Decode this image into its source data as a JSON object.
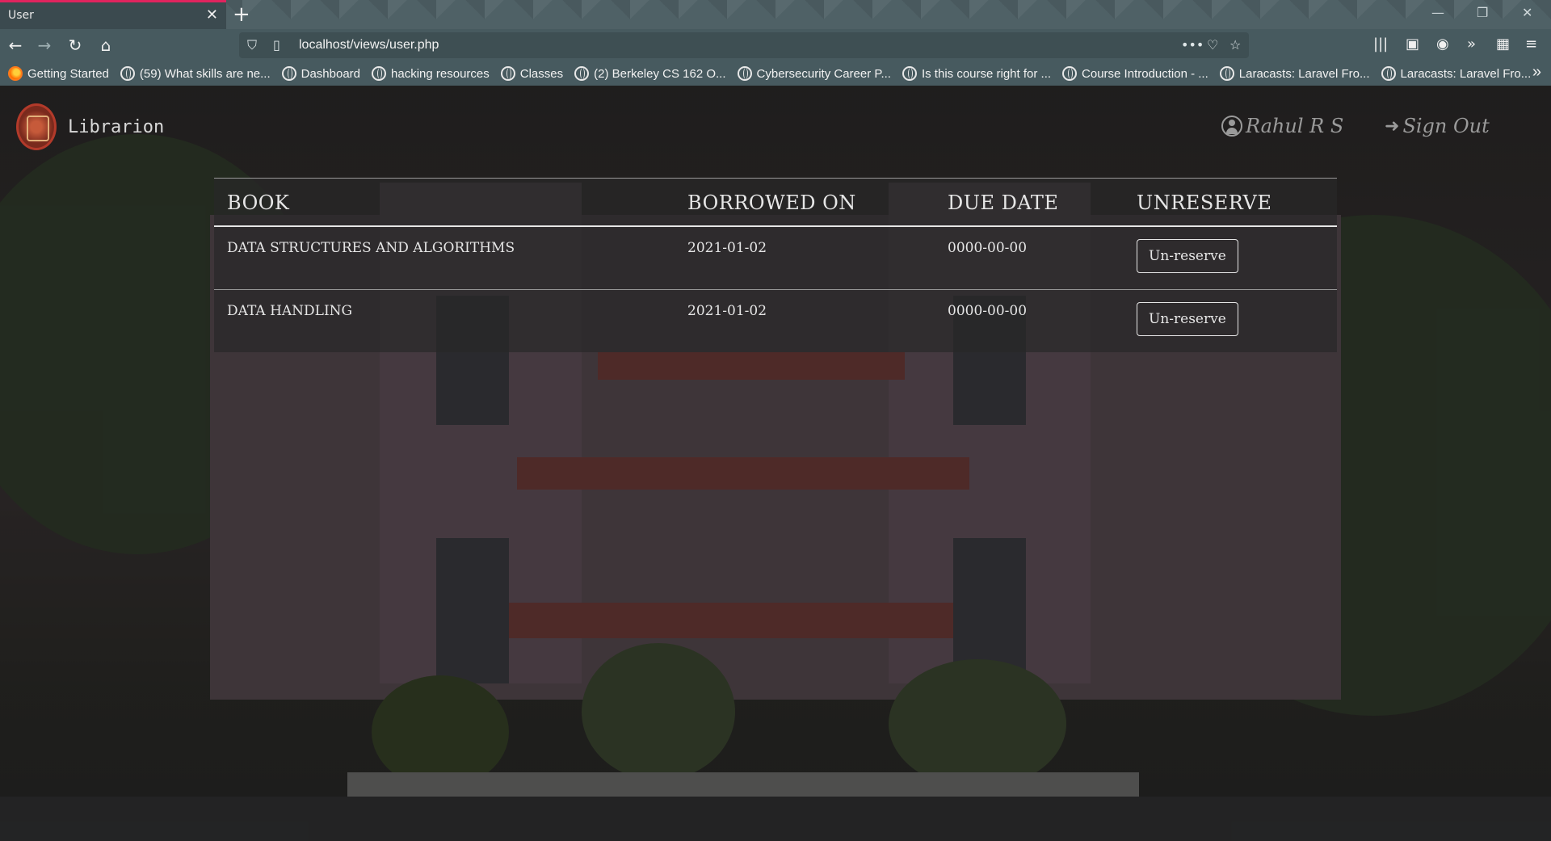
{
  "browser": {
    "tab_title": "User",
    "url": "localhost/views/user.php",
    "bookmarks": [
      {
        "label": "Getting Started",
        "icon": "firefox-icon"
      },
      {
        "label": "(59) What skills are ne...",
        "icon": "globe-icon"
      },
      {
        "label": "Dashboard",
        "icon": "globe-icon"
      },
      {
        "label": "hacking resources",
        "icon": "globe-icon"
      },
      {
        "label": "Classes",
        "icon": "globe-icon"
      },
      {
        "label": "(2) Berkeley CS 162 O...",
        "icon": "globe-icon"
      },
      {
        "label": "Cybersecurity Career P...",
        "icon": "globe-icon"
      },
      {
        "label": "Is this course right for ...",
        "icon": "globe-icon"
      },
      {
        "label": "Course Introduction - ...",
        "icon": "globe-icon"
      },
      {
        "label": "Laracasts: Laravel Fro...",
        "icon": "globe-icon"
      },
      {
        "label": "Laracasts: Laravel Fro...",
        "icon": "globe-icon"
      }
    ]
  },
  "header": {
    "brand": "Librarion",
    "user_name": "Rahul R S",
    "sign_out": "Sign Out"
  },
  "table": {
    "columns": [
      "BOOK",
      "BORROWED ON",
      "DUE DATE",
      "UNRESERVE"
    ],
    "rows": [
      {
        "book": "DATA STRUCTURES AND ALGORITHMS",
        "borrowed_on": "2021-01-02",
        "due_date": "0000-00-00",
        "action": "Un-reserve"
      },
      {
        "book": "DATA HANDLING",
        "borrowed_on": "2021-01-02",
        "due_date": "0000-00-00",
        "action": "Un-reserve"
      }
    ]
  },
  "colors": {
    "tab_accent": "#e0245e",
    "chrome": "#475a5f",
    "table_bg": "rgba(40,40,40,0.72)",
    "text": "#e6e6e6"
  }
}
